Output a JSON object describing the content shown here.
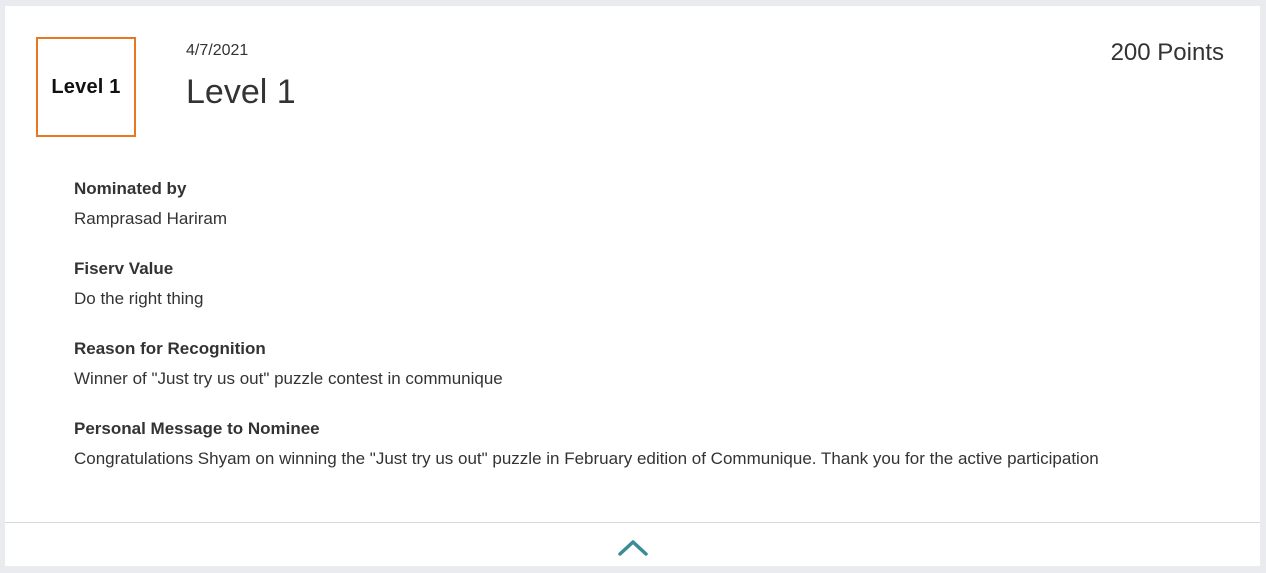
{
  "award": {
    "badge_label": "Level 1",
    "date": "4/7/2021",
    "title": "Level 1",
    "points": "200 Points"
  },
  "fields": [
    {
      "label": "Nominated by",
      "value": "Ramprasad Hariram"
    },
    {
      "label": "Fiserv Value",
      "value": "Do the right thing"
    },
    {
      "label": "Reason for Recognition",
      "value": "Winner of \"Just try us out\" puzzle contest in communique"
    },
    {
      "label": "Personal Message to Nominee",
      "value": "Congratulations Shyam on winning the \"Just try us out\" puzzle in February edition of Communique. Thank you for the active participation"
    }
  ],
  "icons": {
    "collapse": "chevron-up-icon"
  },
  "colors": {
    "badge_border": "#e87722",
    "chevron": "#3a8c99",
    "text": "#333333"
  }
}
